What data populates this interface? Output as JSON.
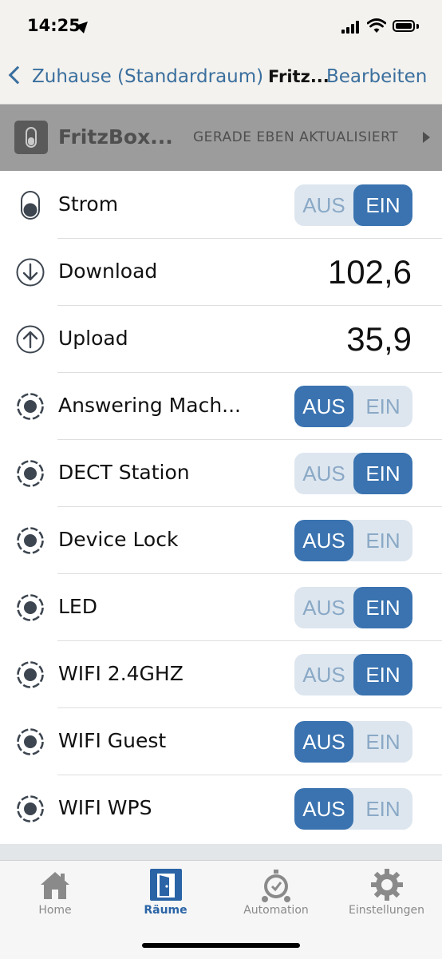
{
  "status_bar": {
    "time": "14:25"
  },
  "nav": {
    "back_label": "Zuhause (Standardraum)",
    "title": "Fritz...",
    "edit_label": "Bearbeiten"
  },
  "device": {
    "name": "FritzBox...",
    "status": "GERADE EBEN AKTUALISIERT"
  },
  "toggle_labels": {
    "off": "AUS",
    "on": "EIN"
  },
  "rows": [
    {
      "label": "Strom",
      "icon": "power-switch-icon",
      "type": "toggle",
      "state": "EIN"
    },
    {
      "label": "Download",
      "icon": "download-arrow-icon",
      "type": "value",
      "value": "102,6"
    },
    {
      "label": "Upload",
      "icon": "upload-arrow-icon",
      "type": "value",
      "value": "35,9"
    },
    {
      "label": "Answering Mach...",
      "icon": "dot-circle-icon",
      "type": "toggle",
      "state": "AUS"
    },
    {
      "label": "DECT Station",
      "icon": "dot-circle-icon",
      "type": "toggle",
      "state": "EIN"
    },
    {
      "label": "Device Lock",
      "icon": "dot-circle-icon",
      "type": "toggle",
      "state": "AUS"
    },
    {
      "label": "LED",
      "icon": "dot-circle-icon",
      "type": "toggle",
      "state": "EIN"
    },
    {
      "label": "WIFI 2.4GHZ",
      "icon": "dot-circle-icon",
      "type": "toggle",
      "state": "EIN"
    },
    {
      "label": "WIFI Guest",
      "icon": "dot-circle-icon",
      "type": "toggle",
      "state": "AUS"
    },
    {
      "label": "WIFI WPS",
      "icon": "dot-circle-icon",
      "type": "toggle",
      "state": "AUS"
    }
  ],
  "tabs": [
    {
      "label": "Home",
      "icon": "house-icon",
      "active": false
    },
    {
      "label": "Räume",
      "icon": "door-icon",
      "active": true
    },
    {
      "label": "Automation",
      "icon": "alarm-clock-icon",
      "active": false
    },
    {
      "label": "Einstellungen",
      "icon": "gear-icon",
      "active": false
    }
  ],
  "colors": {
    "accent": "#3a73b0",
    "toggle_inactive_bg": "#dde6ef",
    "nav_text": "#3a6f9e",
    "header_bg": "#9c9c9c"
  }
}
